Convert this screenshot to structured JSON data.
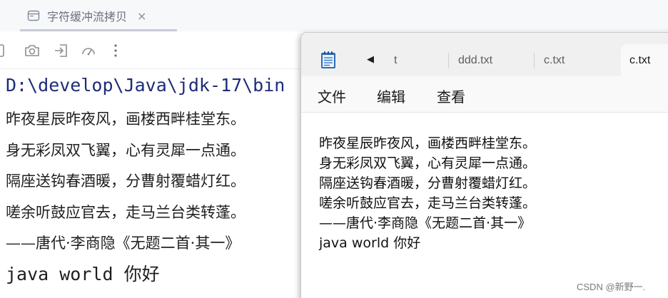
{
  "ide": {
    "tab": {
      "label": "字符缓冲流拷贝",
      "close": "×"
    },
    "toolbar": {
      "icons": [
        "stop-icon",
        "camera-icon",
        "login-icon",
        "gauge-icon",
        "more-vertical-icon"
      ]
    },
    "console": {
      "path_line": "D:\\develop\\Java\\jdk-17\\bin",
      "poem_lines": [
        "昨夜星辰昨夜风，画楼西畔桂堂东。",
        "身无彩凤双飞翼，心有灵犀一点通。",
        "隔座送钩春酒暖，分曹射覆蜡灯红。",
        "嗟余听鼓应官去，走马兰台类转蓬。",
        "——唐代·李商隐《无题二首·其一》"
      ],
      "last_line": "java world 你好"
    }
  },
  "notepad": {
    "scroll_left": "◀",
    "tabs": [
      {
        "label": "t"
      },
      {
        "label": "ddd.txt"
      },
      {
        "label": "c.txt"
      },
      {
        "label": "c.txt"
      }
    ],
    "active_tab": 3,
    "menu": {
      "file": "文件",
      "edit": "编辑",
      "view": "查看"
    },
    "content_lines": [
      "昨夜星辰昨夜风，画楼西畔桂堂东。",
      "身无彩凤双飞翼，心有灵犀一点通。",
      "隔座送钩春酒暖，分曹射覆蜡灯红。",
      "嗟余听鼓应官去，走马兰台类转蓬。",
      "——唐代·李商隐《无题二首·其一》",
      "java world 你好"
    ]
  },
  "watermark": "CSDN @新野一.",
  "colors": {
    "console_path": "#1d2c78",
    "ide_tab_underline": "#c6cbd5",
    "notepad_titlebar": "#f0f0f0",
    "notepad_icon": "#2b6cb8"
  }
}
